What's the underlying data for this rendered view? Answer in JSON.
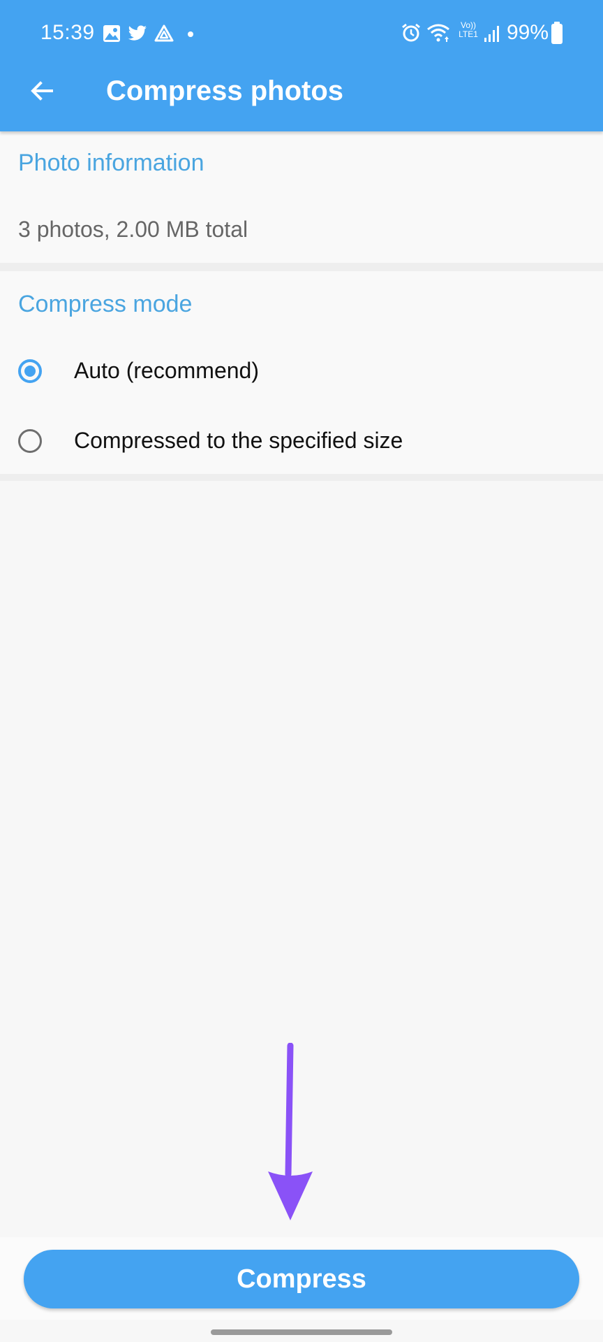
{
  "status_bar": {
    "time": "15:39",
    "battery": "99%",
    "network_label": "Vo)) LTE1",
    "left_icons": [
      "gallery-icon",
      "twitter-icon",
      "drive-icon",
      "dot-icon"
    ],
    "right_icons": [
      "alarm-icon",
      "wifi-icon",
      "volte-icon",
      "signal-icon",
      "battery-icon"
    ]
  },
  "toolbar": {
    "back_icon": "arrow-left-icon",
    "title": "Compress photos"
  },
  "photo_info": {
    "title": "Photo information",
    "summary": "3 photos, 2.00 MB total"
  },
  "compress_mode": {
    "title": "Compress mode",
    "options": [
      {
        "label": "Auto (recommend)",
        "selected": true
      },
      {
        "label": "Compressed to the specified size",
        "selected": false
      }
    ]
  },
  "compress_button": {
    "label": "Compress"
  },
  "colors": {
    "accent": "#44a3f1",
    "section_title": "#4aa5e0",
    "annotation_arrow": "#8a52f7"
  }
}
